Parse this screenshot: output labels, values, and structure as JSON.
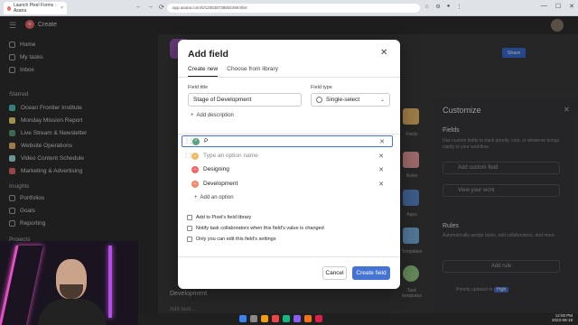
{
  "browser": {
    "tab_title": "Launch Pixel Forms · Asana",
    "tab_close": "×",
    "nav": [
      "←",
      "→",
      "⟳"
    ],
    "url": "app.asana.com/0/1205387388024904/list",
    "window_controls": [
      "—",
      "☐",
      "✕"
    ]
  },
  "app": {
    "create_label": "Create",
    "menu_icon": "☰"
  },
  "sidebar": {
    "top_items": [
      {
        "label": "Home"
      },
      {
        "label": "My tasks"
      },
      {
        "label": "Inbox"
      }
    ],
    "starred_heading": "Starred",
    "projects": [
      {
        "label": "Ocean Frontier Institute",
        "color": "#4ec5c1"
      },
      {
        "label": "Monday Mission Report",
        "color": "#f8df72"
      },
      {
        "label": "Live Stream & Newsletter",
        "color": "#5da283"
      },
      {
        "label": "Website Operations",
        "color": "#f1bd6c"
      },
      {
        "label": "Video Content Schedule",
        "color": "#9ee7e3"
      },
      {
        "label": "Marketing & Advertising",
        "color": "#f06a6a"
      }
    ],
    "insights_heading": "Insights",
    "insight_items": [
      {
        "label": "Portfolios"
      },
      {
        "label": "Goals"
      },
      {
        "label": "Reporting"
      }
    ],
    "projects_heading": "Projects"
  },
  "main": {
    "share_label": "Share",
    "section_development": "Development",
    "add_task": "Add task..."
  },
  "customize": {
    "title": "Customize",
    "close": "✕",
    "fields_heading": "Fields",
    "fields_text": "Use custom fields to track priority, cost, or whatever brings clarity to your workflow.",
    "add_custom_field": "Add custom field",
    "view_work": "View your work",
    "rules_heading": "Rules",
    "rules_text": "Automatically assign tasks, add collaborators, and more.",
    "add_rule": "Add rule",
    "priority_updated": "Priority updated to",
    "priority_badge": "High",
    "gallery": [
      "Fields",
      "Rules",
      "Apps",
      "Templates",
      "Task templates"
    ]
  },
  "modal": {
    "title": "Add field",
    "close": "✕",
    "tabs": [
      {
        "label": "Create new",
        "active": true
      },
      {
        "label": "Choose from library",
        "active": false
      }
    ],
    "field_title_label": "Field title",
    "field_title_value": "Stage of Development",
    "field_type_label": "Field type",
    "field_type_value": "Single-select",
    "add_description": "Add description",
    "options": [
      {
        "text": "P",
        "color": "#5da283",
        "placeholder": false
      },
      {
        "text": "Type an option name",
        "color": "#f1bd6c",
        "placeholder": true
      },
      {
        "text": "Designing",
        "color": "#f06a6a",
        "placeholder": false
      },
      {
        "text": "Development",
        "color": "#ec8d71",
        "placeholder": false
      }
    ],
    "add_option": "Add an option",
    "checkboxes": [
      "Add to Pixel's field library",
      "Notify task collaborators when this field's value is changed",
      "Only you can edit this field's settings"
    ],
    "cancel": "Cancel",
    "create": "Create field"
  },
  "taskbar": {
    "time": "12:00 PM",
    "date": "2023-09-19"
  }
}
